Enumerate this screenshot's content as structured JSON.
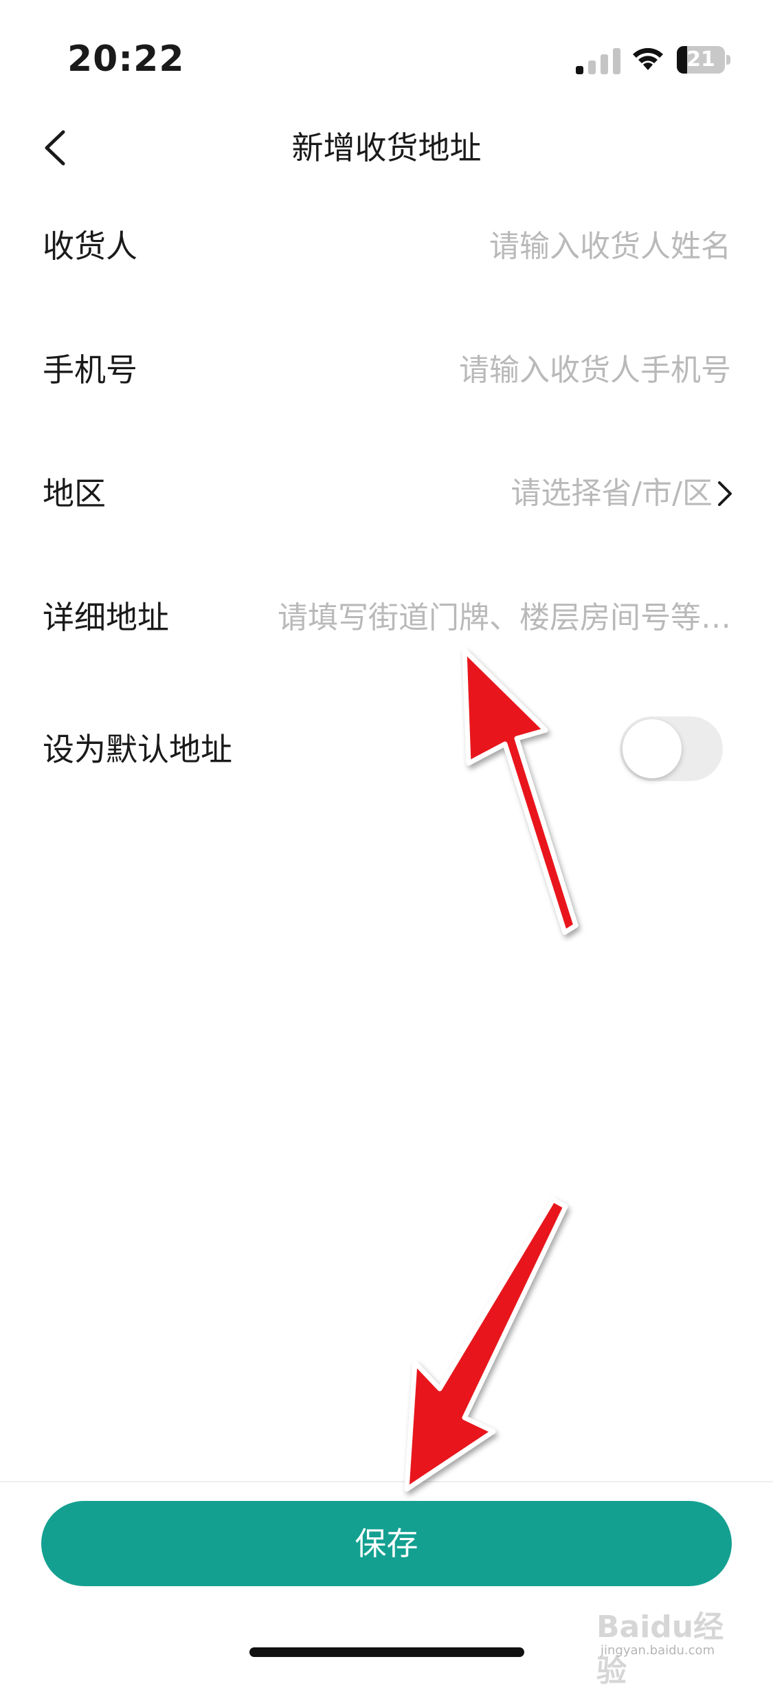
{
  "status_bar": {
    "time": "20:22",
    "battery_level": "21",
    "battery_fraction": 0.21,
    "icons": [
      "cellular-signal-icon",
      "wifi-icon",
      "battery-icon"
    ]
  },
  "nav": {
    "title": "新增收货地址",
    "back_icon": "chevron-left-icon"
  },
  "form": {
    "recipient": {
      "label": "收货人",
      "value": "",
      "placeholder": "请输入收货人姓名"
    },
    "phone": {
      "label": "手机号",
      "value": "",
      "placeholder": "请输入收货人手机号"
    },
    "region": {
      "label": "地区",
      "placeholder": "请选择省/市/区"
    },
    "detail": {
      "label": "详细地址",
      "value": "",
      "placeholder": "请填写街道门牌、楼层房间号等…"
    },
    "default": {
      "label": "设为默认地址",
      "enabled": false
    }
  },
  "save_button": {
    "label": "保存"
  },
  "colors": {
    "accent": "#14a091",
    "placeholder": "#b9b9b9",
    "annotation_arrow": "#e8141e"
  },
  "watermark": {
    "text": "Baidu经验",
    "sub": "jingyan.baidu.com"
  }
}
